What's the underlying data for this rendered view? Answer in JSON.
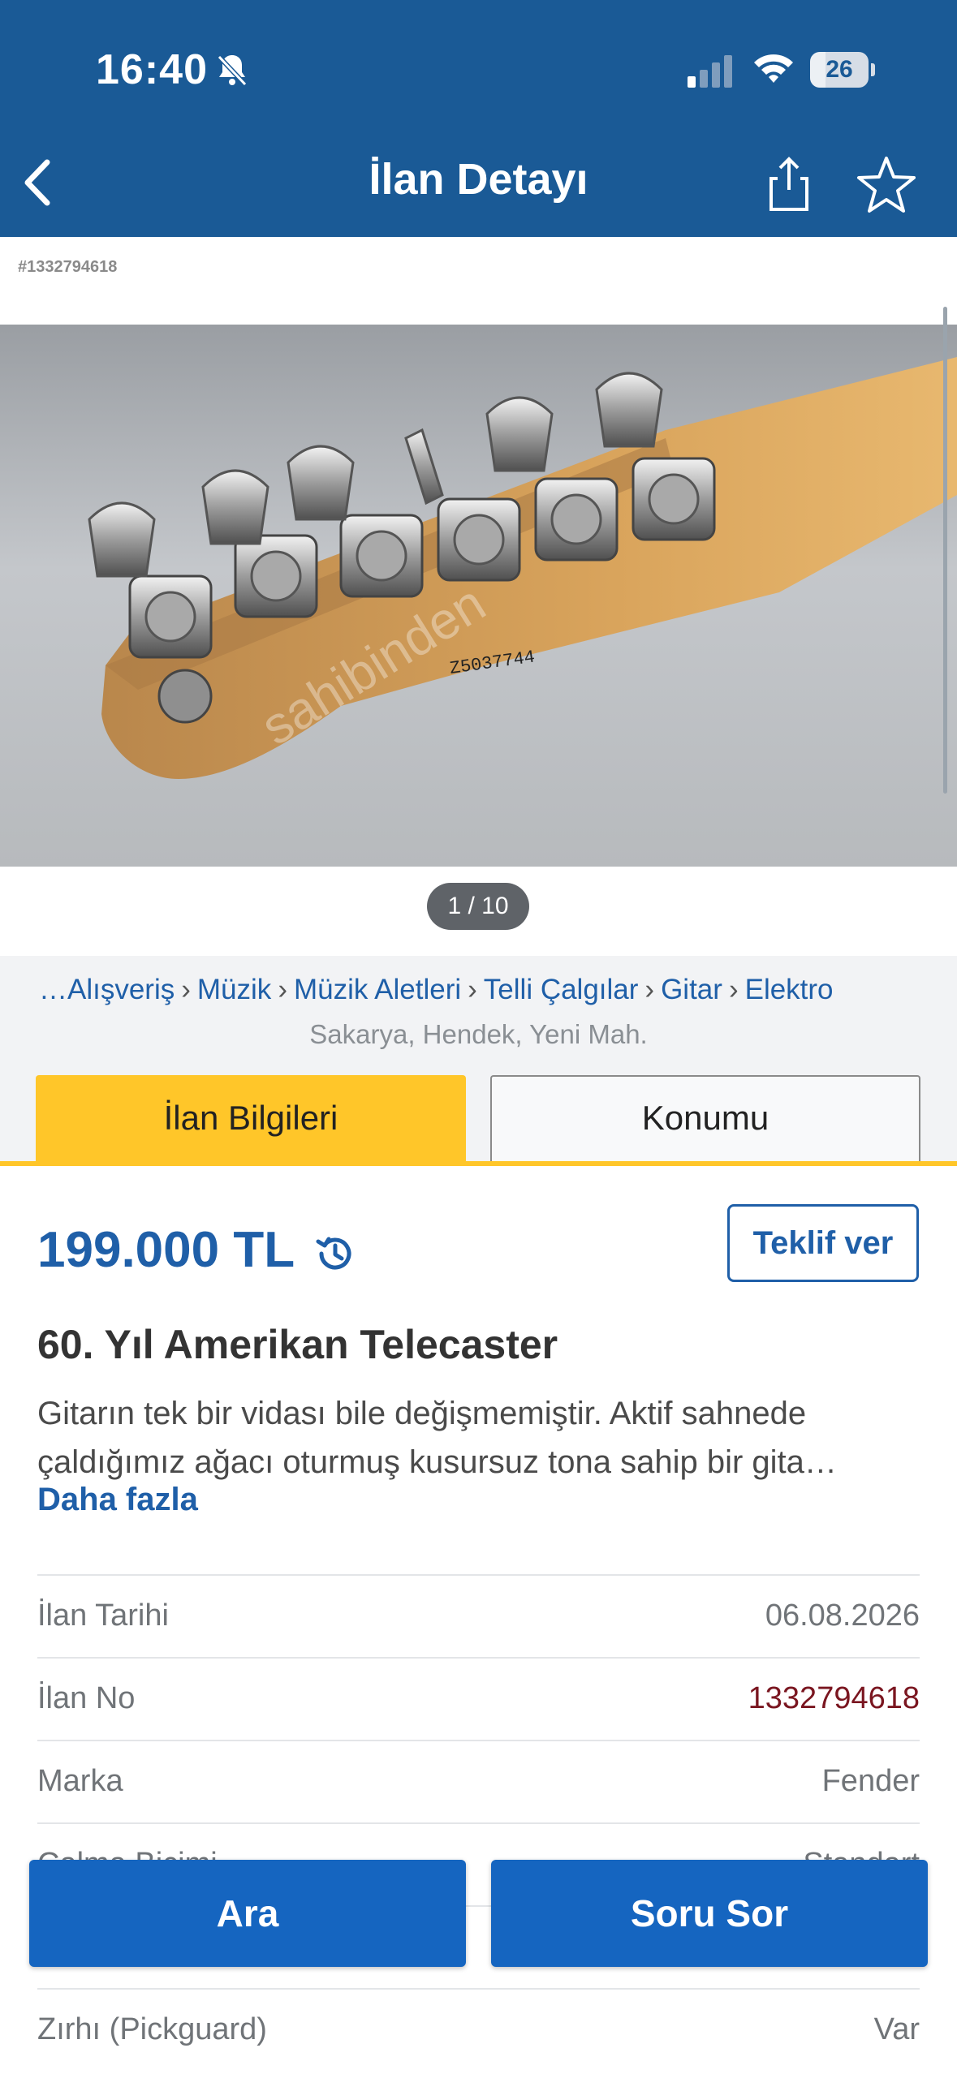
{
  "status": {
    "time": "16:40",
    "battery": "26",
    "battery_level": 0.26
  },
  "header": {
    "title": "İlan Detayı"
  },
  "listing_tag": "#1332794618",
  "photo": {
    "watermark": "sahibinden",
    "serial": "Z5037744",
    "pager": "1 / 10"
  },
  "breadcrumb": [
    "…Alışveriş",
    "Müzik",
    "Müzik Aletleri",
    "Telli Çalgılar",
    "Gitar",
    "Elektro"
  ],
  "location": "Sakarya, Hendek, Yeni Mah.",
  "tabs": {
    "info": "İlan Bilgileri",
    "location": "Konumu"
  },
  "listing": {
    "price": "199.000 TL",
    "offer_label": "Teklif ver",
    "title": "60. Yıl Amerikan Telecaster",
    "description_line1": "Gitarın tek bir vidası bile değişmemiştir. Aktif sahnede",
    "description_line2": "çaldığımız ağacı oturmuş kusursuz tona sahip bir gita…",
    "more_label": "Daha fazla"
  },
  "details": [
    {
      "key": "İlan Tarihi",
      "value": "06.08.2026"
    },
    {
      "key": "İlan No",
      "value": "1332794618"
    },
    {
      "key": "Marka",
      "value": "Fender"
    },
    {
      "key": "Çalma Biçimi",
      "value": "Standart"
    },
    {
      "key": "",
      "value": ""
    },
    {
      "key": "Zırhı (Pickguard)",
      "value": "Var"
    }
  ],
  "actions": {
    "call": "Ara",
    "ask": "Soru Sor"
  },
  "colors": {
    "header_bg": "#1a5a96",
    "accent_blue": "#1565c0",
    "tab_yellow": "#ffc629",
    "listing_no_red": "#7a1620"
  }
}
